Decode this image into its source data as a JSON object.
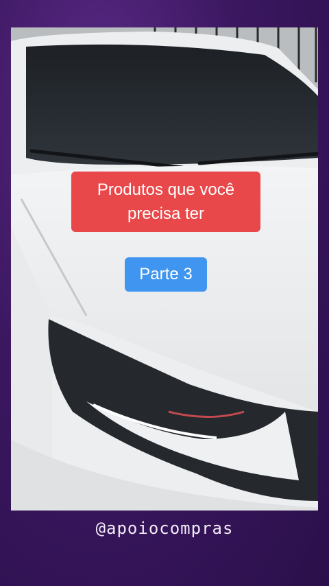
{
  "caption": {
    "line1": "Produtos que você",
    "line2": "precisa ter",
    "part": "Parte 3"
  },
  "footer": {
    "handle": "@apoiocompras"
  },
  "colors": {
    "frame_background": "#3b1760",
    "caption_red": "#e8484a",
    "caption_blue": "#3f95ef"
  }
}
